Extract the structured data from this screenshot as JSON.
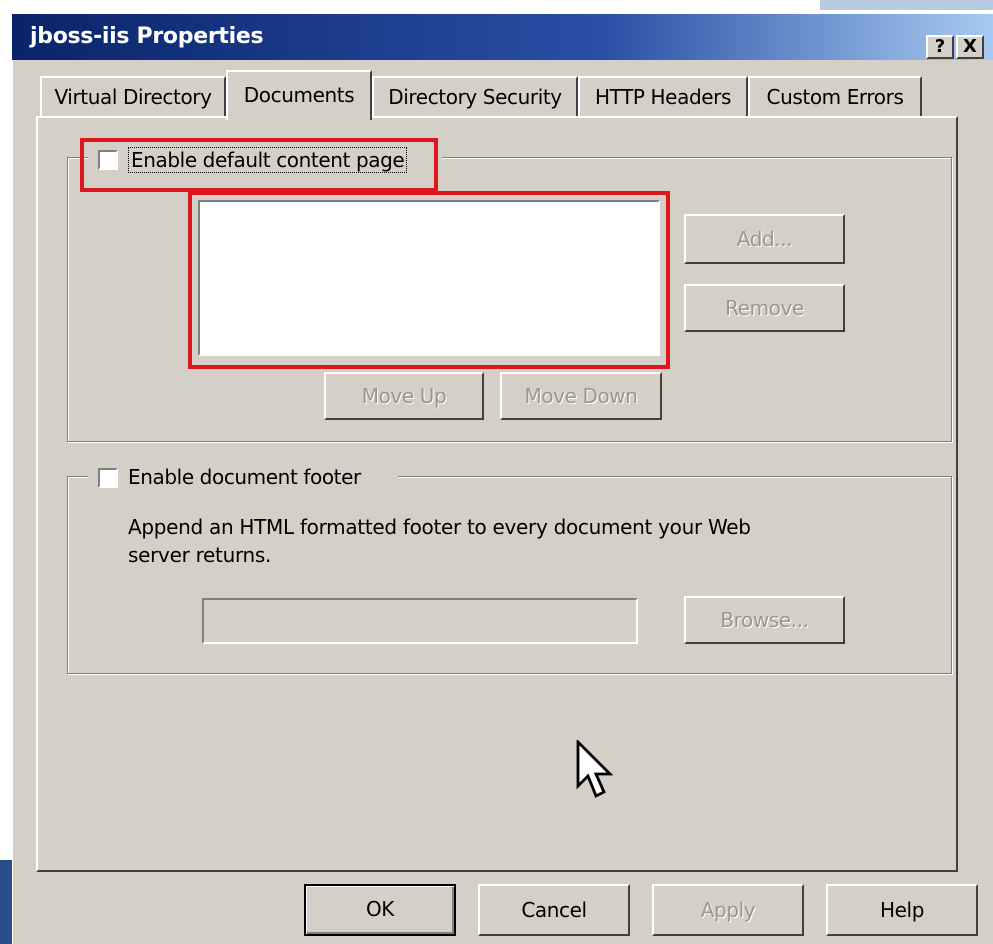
{
  "window": {
    "title": "jboss-iis Properties",
    "help_button": "?",
    "close_button": "X"
  },
  "tabs": [
    {
      "label": "Virtual Directory",
      "active": false
    },
    {
      "label": "Documents",
      "active": true
    },
    {
      "label": "Directory Security",
      "active": false
    },
    {
      "label": "HTTP Headers",
      "active": false
    },
    {
      "label": "Custom Errors",
      "active": false
    }
  ],
  "default_content": {
    "checkbox_label": "Enable default content page",
    "checked": false,
    "list_items": [],
    "add_button": "Add...",
    "remove_button": "Remove",
    "move_up_button": "Move Up",
    "move_down_button": "Move Down"
  },
  "document_footer": {
    "checkbox_label": "Enable document footer",
    "checked": false,
    "description": "Append an HTML formatted footer to every document your Web server returns.",
    "path_value": "",
    "browse_button": "Browse..."
  },
  "footer_buttons": {
    "ok": "OK",
    "cancel": "Cancel",
    "apply": "Apply",
    "help": "Help"
  },
  "colors": {
    "highlight_red": "#e0161e",
    "title_bar": "#0a246a",
    "dialog_bg": "#d4d0c8"
  },
  "icons": {
    "cursor": "arrow-cursor-icon"
  }
}
